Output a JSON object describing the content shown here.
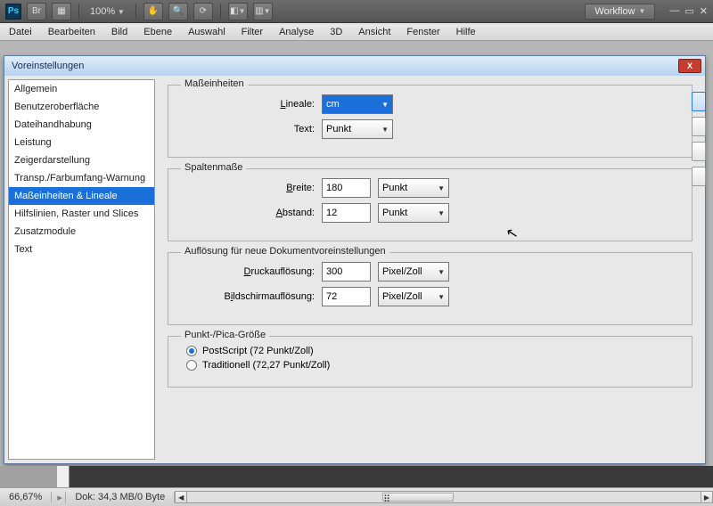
{
  "app": {
    "zoom": "100%",
    "workflow": "Workflow"
  },
  "menus": [
    "Datei",
    "Bearbeiten",
    "Bild",
    "Ebene",
    "Auswahl",
    "Filter",
    "Analyse",
    "3D",
    "Ansicht",
    "Fenster",
    "Hilfe"
  ],
  "dialog": {
    "title": "Voreinstellungen",
    "sidebar": [
      "Allgemein",
      "Benutzeroberfläche",
      "Dateihandhabung",
      "Leistung",
      "Zeigerdarstellung",
      "Transp./Farbumfang-Warnung",
      "Maßeinheiten & Lineale",
      "Hilfslinien, Raster und Slices",
      "Zusatzmodule",
      "Text"
    ],
    "selectedIndex": 6,
    "units": {
      "legend": "Maßeinheiten",
      "rulers_label": "Lineale:",
      "rulers_value": "cm",
      "text_label": "Text:",
      "text_value": "Punkt"
    },
    "columns": {
      "legend": "Spaltenmaße",
      "width_label": "Breite:",
      "width_value": "180",
      "width_unit": "Punkt",
      "gutter_label": "Abstand:",
      "gutter_value": "12",
      "gutter_unit": "Punkt"
    },
    "resolution": {
      "legend": "Auflösung für neue Dokumentvoreinstellungen",
      "print_label": "Druckauflösung:",
      "print_value": "300",
      "print_unit": "Pixel/Zoll",
      "screen_label": "Bildschirmauflösung:",
      "screen_value": "72",
      "screen_unit": "Pixel/Zoll"
    },
    "pica": {
      "legend": "Punkt-/Pica-Größe",
      "opt1": "PostScript (72 Punkt/Zoll)",
      "opt2": "Traditionell (72,27 Punkt/Zoll)",
      "selected": 0
    }
  },
  "status": {
    "zoom": "66,67%",
    "doc": "Dok: 34,3 MB/0 Byte"
  }
}
